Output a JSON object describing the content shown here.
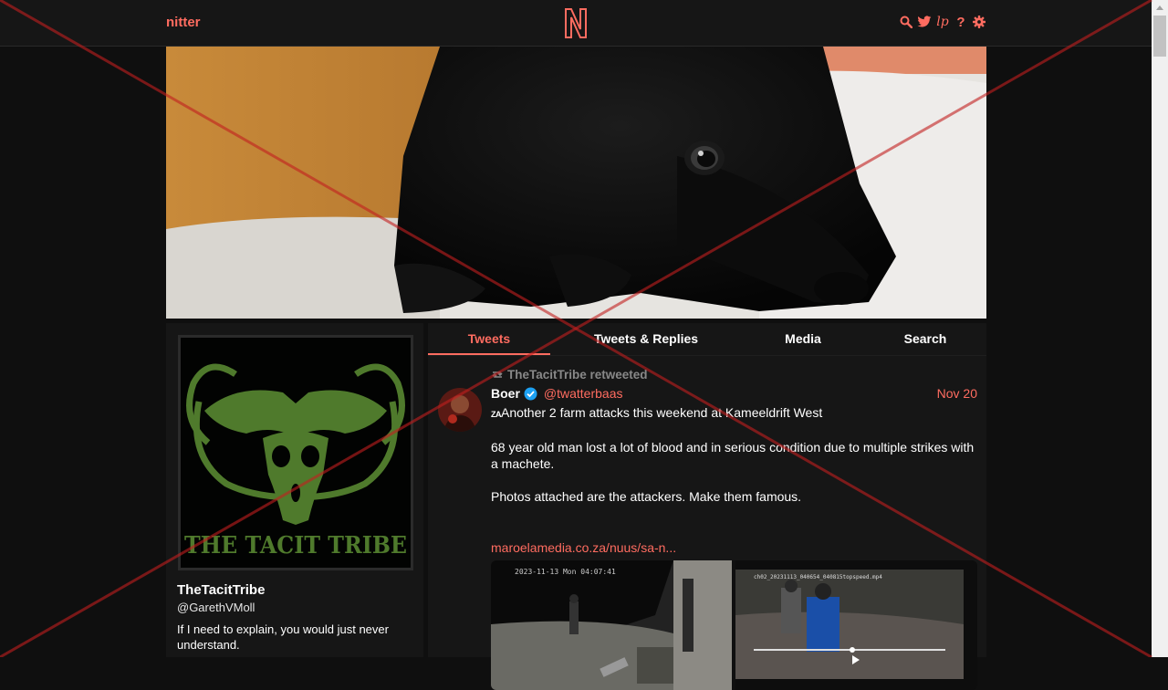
{
  "nav": {
    "brand": "nitter",
    "logo_letter": "N",
    "icons": [
      "search-icon",
      "twitter-bird-icon",
      "liberapay-icon",
      "help-icon",
      "settings-gear-icon"
    ],
    "help_glyph": "?",
    "lp_glyph": "lp"
  },
  "profile": {
    "avatar_text": "THE TACIT TRIBE",
    "fullname": "TheTacitTribe",
    "username": "@GarethVMoll",
    "bio": "If I need to explain, you would just never understand."
  },
  "tabs": [
    {
      "label": "Tweets",
      "active": true
    },
    {
      "label": "Tweets & Replies",
      "active": false
    },
    {
      "label": "Media",
      "active": false
    },
    {
      "label": "Search",
      "active": false
    }
  ],
  "tweet": {
    "retweet_text": "TheTacitTribe retweeted",
    "fullname": "Boer",
    "verified": true,
    "username": "@twatterbaas",
    "date": "Nov 20",
    "flag": "ZA",
    "line1": "Another 2 farm attacks this weekend at Kameeldrift West",
    "line2": "68 year old man lost a lot of blood and in serious condition due to multiple strikes with a machete.",
    "line3": "Photos attached are the attackers. Make them famous.",
    "link": "maroelamedia.co.za/nuus/sa-n...",
    "attachments": [
      {
        "caption": "2023-11-13 Mon 04:07:41"
      },
      {
        "caption": "ch02_20231113_040654_040815topspeed.mp4"
      }
    ]
  },
  "colors": {
    "accent": "#ff6c60",
    "background": "#0f0f0f",
    "panel": "#161616",
    "overlay_cross": "#c21f1f"
  }
}
